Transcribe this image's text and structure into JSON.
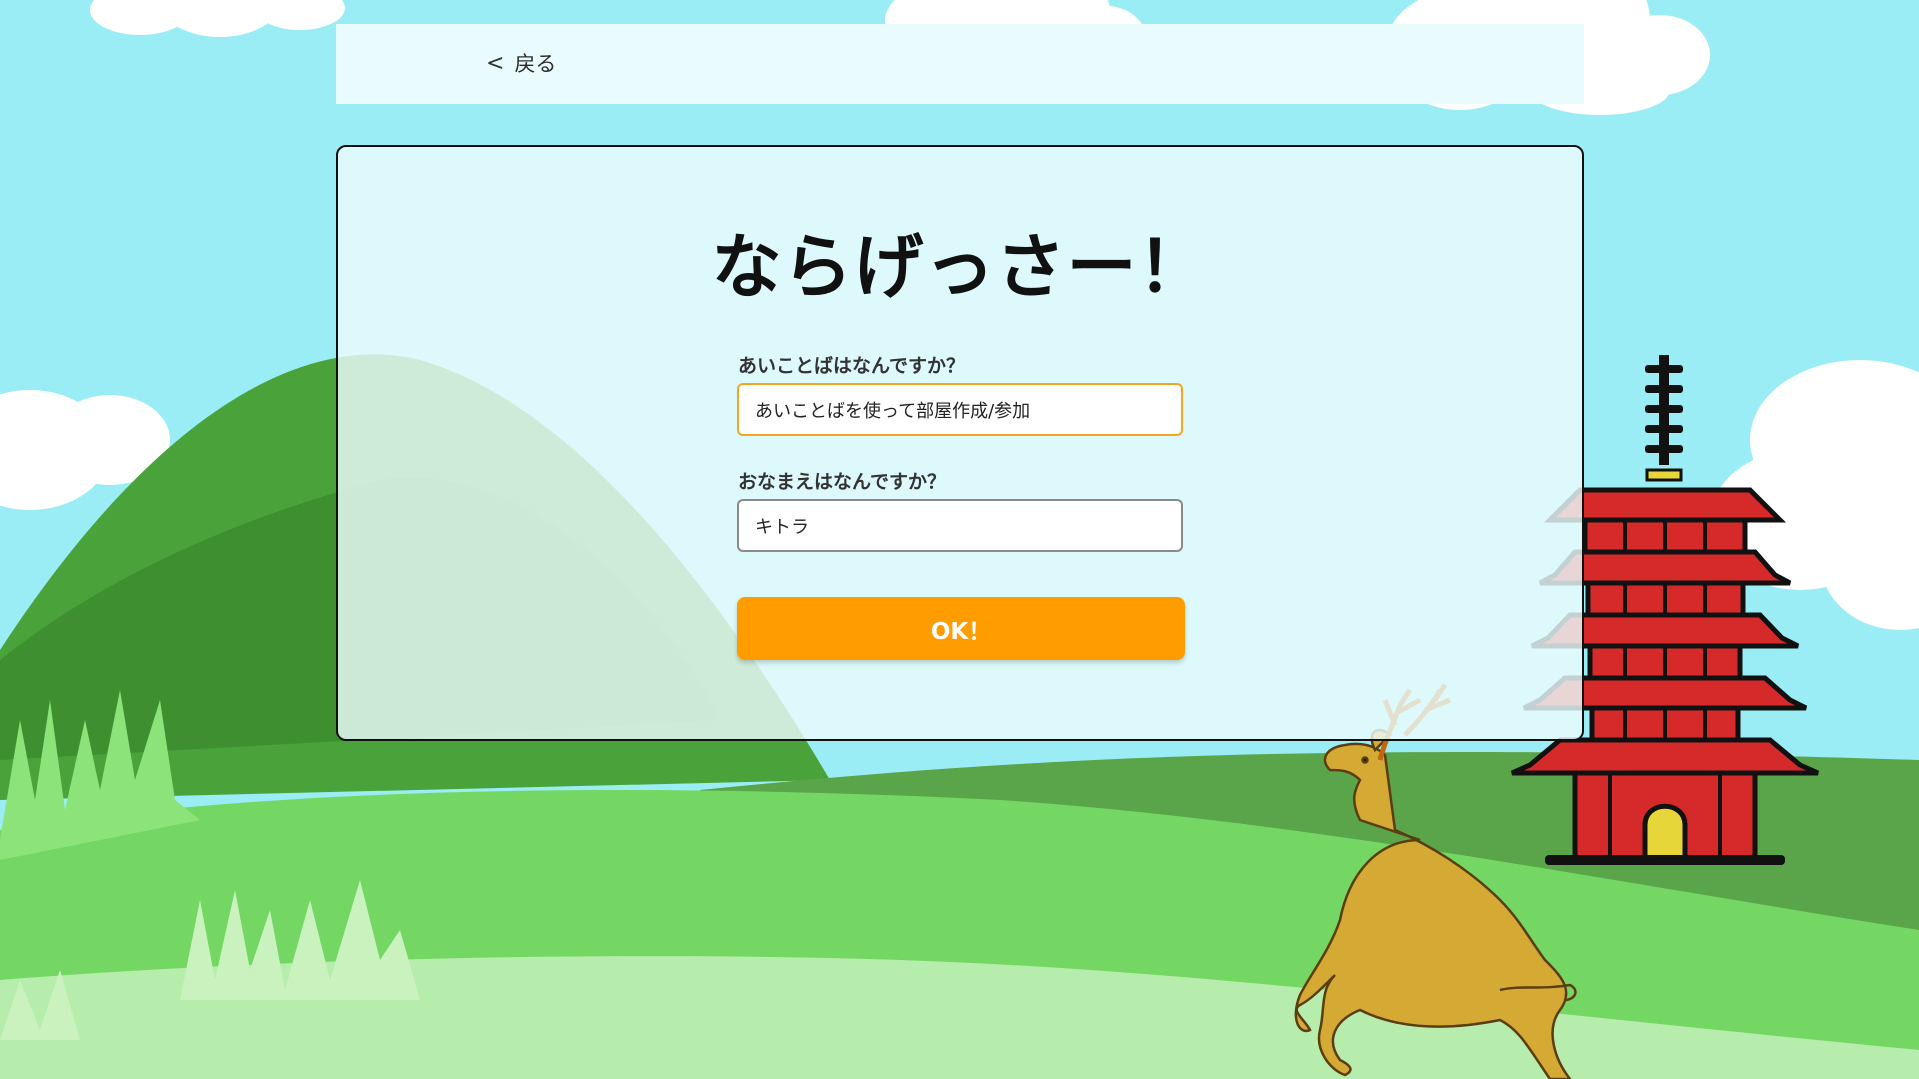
{
  "nav": {
    "back_label": "戻る"
  },
  "title": "ならげっさー！",
  "form": {
    "passphrase_label": "あいことばはなんですか？",
    "passphrase_value": "あいことばを使って部屋作成/参加",
    "name_label": "おなまえはなんですか？",
    "name_value": "キトラ",
    "ok_label": "OK！"
  },
  "colors": {
    "sky": "#9aedf4",
    "accent": "#ff9c00",
    "input_focus_border": "#f4a523",
    "pagoda_red": "#d62a2a",
    "deer": "#d4aa35"
  }
}
